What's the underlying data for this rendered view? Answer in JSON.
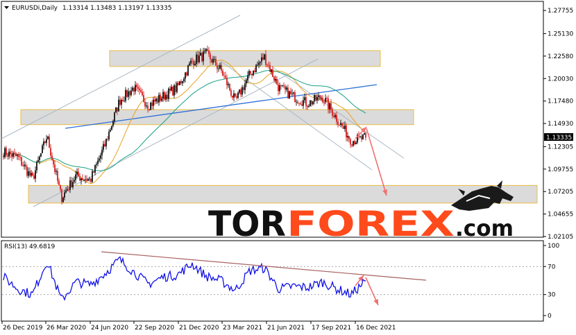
{
  "header": {
    "symbol": "EURUSDi,Daily",
    "ohlc": "1.13314 1.13483 1.13197 1.13335"
  },
  "rsi_header": "RSI(13) 49.6819",
  "watermark": {
    "part1": "TOR",
    "part2": "FOREX",
    "part3": ".com"
  },
  "colors": {
    "candle_up": "#111111",
    "candle_down": "#d81e1e",
    "ma_fast": "#e6a020",
    "ma_slow": "#16a085",
    "trend_blue": "#2c6fd6",
    "channel": "#a9b8c4",
    "zone_fill": "#d8d8d8",
    "zone_border": "#e8b530",
    "rsi_line": "#1010e8",
    "rsi_trend": "#a86060",
    "arrow": "#f07070",
    "brand_orange": "#ff4a1c"
  },
  "chart_data": [
    {
      "type": "candlestick",
      "title": "EURUSDi,Daily",
      "ylim": [
        1.02105,
        1.28
      ],
      "y_tick_labels": [
        "1.27755",
        "1.25130",
        "1.22580",
        "1.20030",
        "1.17480",
        "1.14930",
        "1.12305",
        "1.09755",
        "1.07205",
        "1.04655",
        "1.02105"
      ],
      "current_price": "1.13335",
      "x_tick_labels": [
        "26 Dec 2019",
        "26 Mar 2020",
        "24 Jun 2020",
        "22 Sep 2020",
        "21 Dec 2020",
        "23 Mar 2021",
        "21 Jun 2021",
        "17 Sep 2021",
        "16 Dec 2021"
      ],
      "path_keypoints": [
        [
          "26 Dec 2019",
          1.117
        ],
        [
          "Jan 2020",
          1.111
        ],
        [
          "Feb 2020",
          1.086
        ],
        [
          "Mar 2020",
          1.135
        ],
        [
          "Mar 2020",
          1.065
        ],
        [
          "Apr 2020",
          1.09
        ],
        [
          "May 2020",
          1.085
        ],
        [
          "Jun 2020",
          1.125
        ],
        [
          "Jul 2020",
          1.175
        ],
        [
          "Aug 2020",
          1.19
        ],
        [
          "Sep 2020",
          1.17
        ],
        [
          "Oct 2020",
          1.18
        ],
        [
          "Nov 2020",
          1.19
        ],
        [
          "Dec 2020",
          1.22
        ],
        [
          "Jan 2021",
          1.228
        ],
        [
          "Feb 2021",
          1.21
        ],
        [
          "Mar 2021",
          1.174
        ],
        [
          "Apr 2021",
          1.205
        ],
        [
          "May 2021",
          1.225
        ],
        [
          "Jun 2021",
          1.19
        ],
        [
          "Jul 2021",
          1.18
        ],
        [
          "Aug 2021",
          1.172
        ],
        [
          "Sep 2021",
          1.18
        ],
        [
          "Oct 2021",
          1.155
        ],
        [
          "Nov 2021",
          1.13
        ],
        [
          "Dec 2021",
          1.133
        ]
      ],
      "zones": [
        [
          1.214,
          1.232
        ],
        [
          1.148,
          1.165
        ],
        [
          1.059,
          1.079
        ]
      ]
    },
    {
      "type": "line",
      "title": "RSI(13) 49.6819",
      "ylim": [
        0,
        100
      ],
      "y_tick_labels": [
        "100",
        "70",
        "30",
        "0"
      ],
      "levels": [
        70,
        30
      ],
      "path_keypoints": [
        [
          "Dec 2019",
          55
        ],
        [
          "Jan 2020",
          38
        ],
        [
          "Feb 2020",
          30
        ],
        [
          "Mar 2020",
          78
        ],
        [
          "Mar 2020",
          22
        ],
        [
          "Apr 2020",
          48
        ],
        [
          "May 2020",
          44
        ],
        [
          "Jun 2020",
          60
        ],
        [
          "Jul 2020",
          80
        ],
        [
          "Aug 2020",
          62
        ],
        [
          "Sep 2020",
          45
        ],
        [
          "Oct 2020",
          55
        ],
        [
          "Nov 2020",
          58
        ],
        [
          "Dec 2020",
          74
        ],
        [
          "Jan 2021",
          56
        ],
        [
          "Feb 2021",
          50
        ],
        [
          "Mar 2021",
          36
        ],
        [
          "Apr 2021",
          64
        ],
        [
          "May 2021",
          68
        ],
        [
          "Jun 2021",
          38
        ],
        [
          "Jul 2021",
          42
        ],
        [
          "Aug 2021",
          40
        ],
        [
          "Sep 2021",
          48
        ],
        [
          "Oct 2021",
          38
        ],
        [
          "Nov 2021",
          30
        ],
        [
          "Dec 2021",
          49.7
        ]
      ]
    }
  ]
}
